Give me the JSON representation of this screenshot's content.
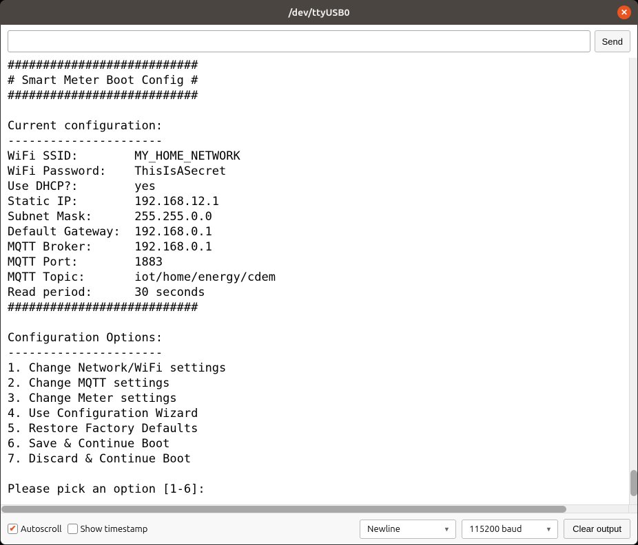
{
  "window": {
    "title": "/dev/ttyUSB0"
  },
  "toolbar": {
    "input_value": "",
    "send_label": "Send"
  },
  "terminal": {
    "text": "###########################\n# Smart Meter Boot Config #\n###########################\n\nCurrent configuration:\n----------------------\nWiFi SSID:        MY_HOME_NETWORK\nWiFi Password:    ThisIsASecret\nUse DHCP?:        yes\nStatic IP:        192.168.12.1\nSubnet Mask:      255.255.0.0\nDefault Gateway:  192.168.0.1\nMQTT Broker:      192.168.0.1\nMQTT Port:        1883\nMQTT Topic:       iot/home/energy/cdem\nRead period:      30 seconds\n###########################\n\nConfiguration Options:\n----------------------\n1. Change Network/WiFi settings\n2. Change MQTT settings\n3. Change Meter settings\n4. Use Configuration Wizard\n5. Restore Factory Defaults\n6. Save & Continue Boot\n7. Discard & Continue Boot\n\nPlease pick an option [1-6]: "
  },
  "bottom": {
    "autoscroll_label": "Autoscroll",
    "autoscroll_checked": true,
    "timestamp_label": "Show timestamp",
    "timestamp_checked": false,
    "line_ending_selected": "Newline",
    "baud_selected": "115200 baud",
    "clear_label": "Clear output"
  }
}
